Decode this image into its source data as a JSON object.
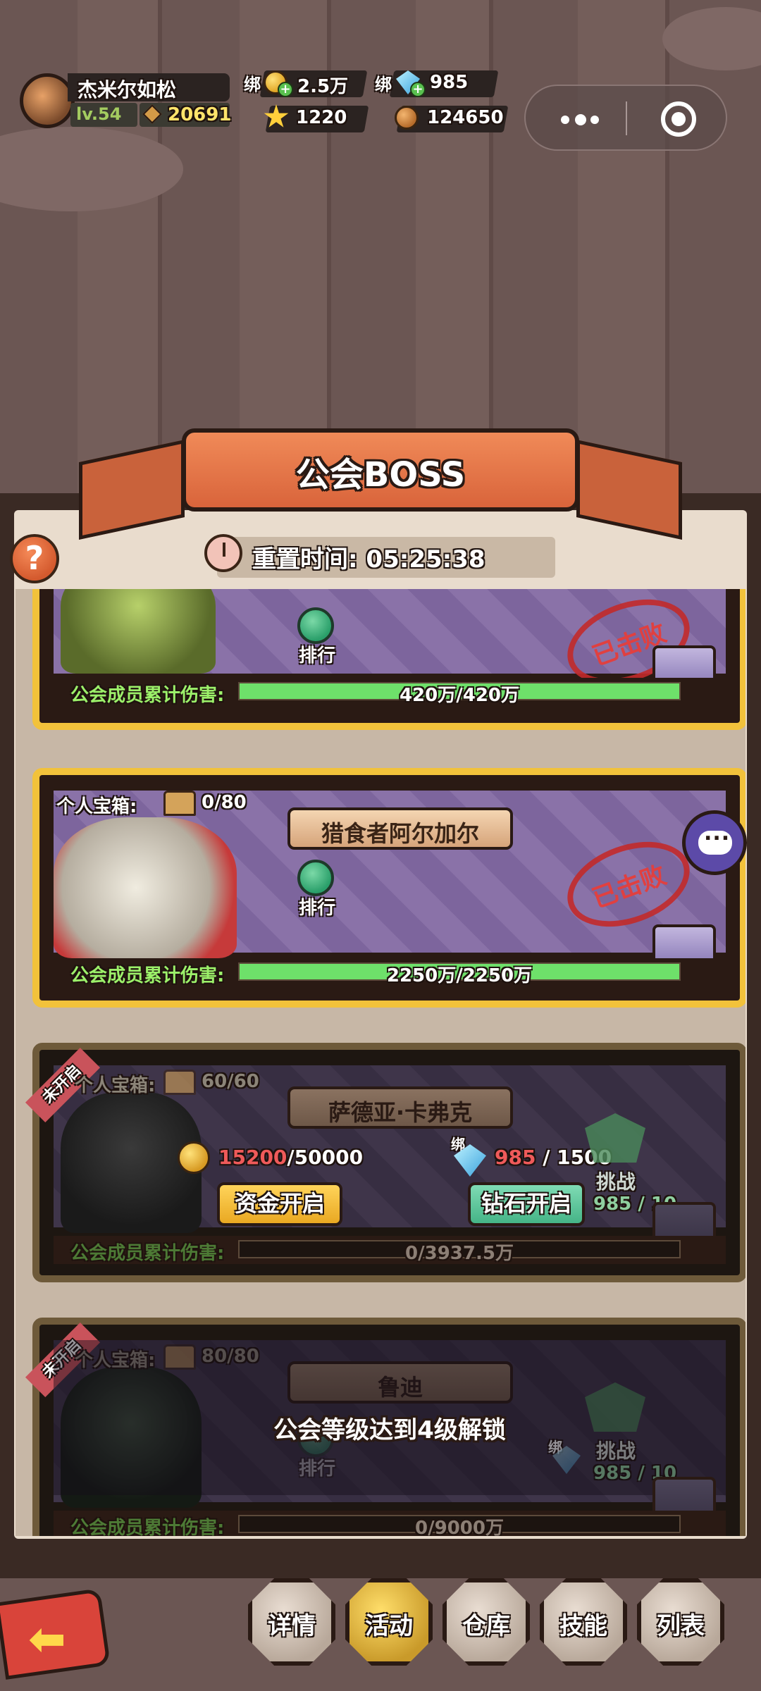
{
  "hud": {
    "player_name": "杰米尔如松",
    "level": "lv.54",
    "power": "20691",
    "bound_gold_label": "绑",
    "bound_gold": "2.5万",
    "bound_gem_label": "绑",
    "bound_gem": "985",
    "stars": "1220",
    "copper": "124650"
  },
  "header": {
    "title": "公会BOSS",
    "help": "?",
    "reset_label": "重置时间: 05:25:38"
  },
  "bosses": [
    {
      "name": "",
      "rank_label": "排行",
      "defeated_label": "已击败",
      "damage_label": "公会成员累计伤害:",
      "damage_text": "420万/420万",
      "damage_progress": 1.0
    },
    {
      "name": "猎食者阿尔加尔",
      "chest_label": "个人宝箱:",
      "chest_count": "0/80",
      "rank_label": "排行",
      "defeated_label": "已击败",
      "damage_label": "公会成员累计伤害:",
      "damage_text": "2250万/2250万",
      "damage_progress": 1.0
    },
    {
      "name": "萨德亚·卡弗克",
      "status_tag": "未开启",
      "chest_label": "个人宝箱:",
      "chest_count": "60/60",
      "gold_cost_current": "15200",
      "gold_cost_total": "/50000",
      "gem_bind_label": "绑",
      "gem_cost_current": "985",
      "gem_cost_total": " / 1500",
      "gold_open_button": "资金开启",
      "gem_open_button": "钻石开启",
      "challenge_label": "挑战",
      "challenge_count": "985 / 10",
      "damage_label": "公会成员累计伤害:",
      "damage_text": "0/3937.5万",
      "damage_progress": 0
    },
    {
      "name": "鲁迪",
      "status_tag": "未开启",
      "chest_label": "个人宝箱:",
      "chest_count": "80/80",
      "unlock_text": "公会等级达到4级解锁",
      "rank_label": "排行",
      "challenge_label": "挑战",
      "gem_bind_label": "绑",
      "challenge_count": "985 / 10",
      "damage_label": "公会成员累计伤害:",
      "damage_text": "0/9000万",
      "damage_progress": 0
    }
  ],
  "nav": {
    "back": "",
    "details": "详情",
    "activity": "活动",
    "warehouse": "仓库",
    "skills": "技能",
    "list": "列表"
  }
}
